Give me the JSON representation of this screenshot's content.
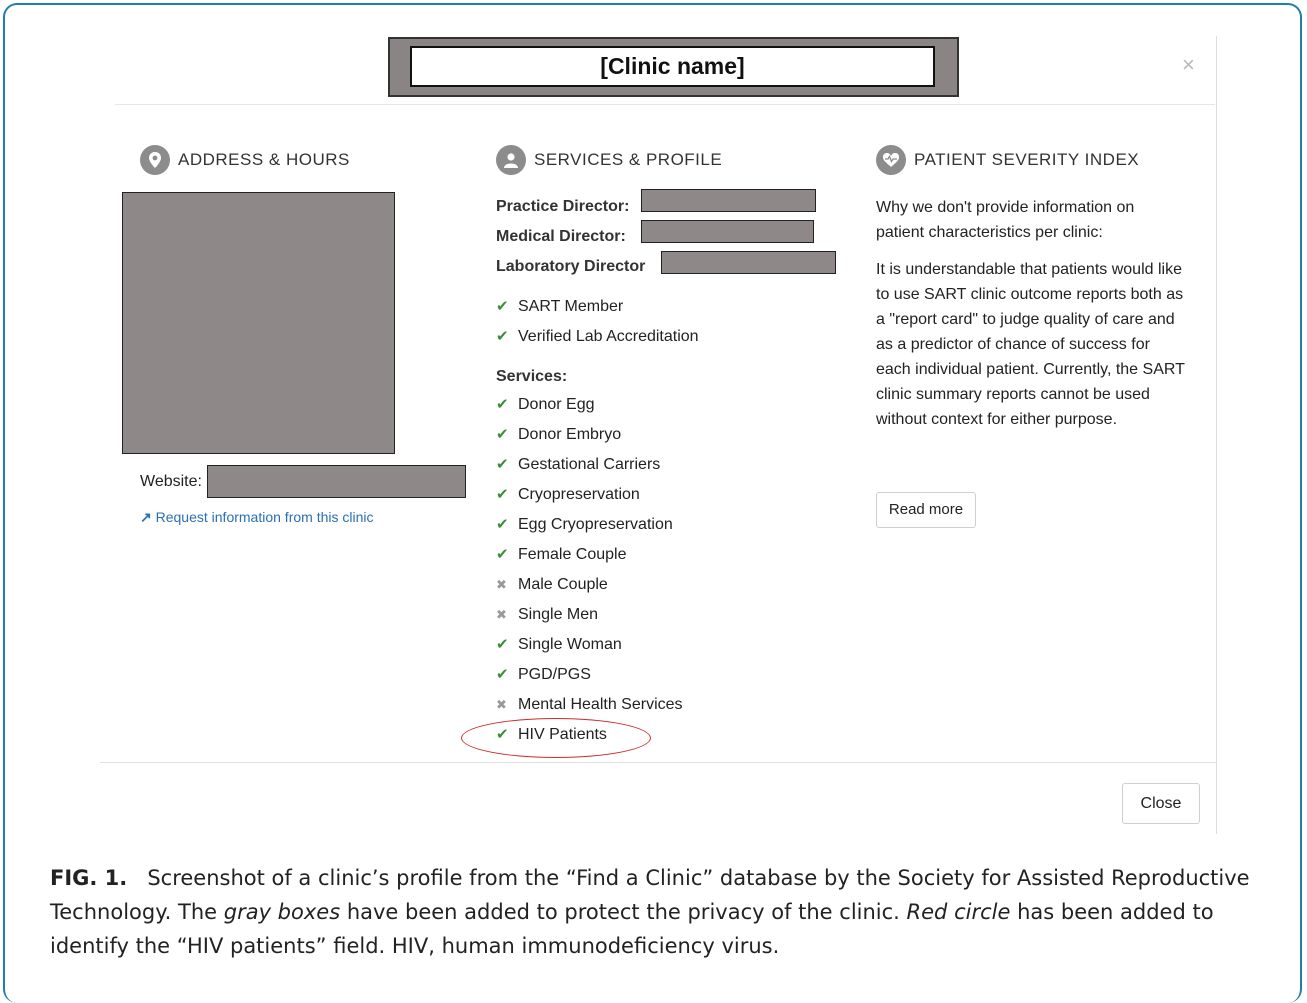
{
  "modal": {
    "title": "[Clinic name]",
    "close_x": "×",
    "close_button": "Close"
  },
  "address": {
    "heading": "ADDRESS & HOURS",
    "website_label": "Website:",
    "request_link": "Request information from this clinic"
  },
  "services_profile": {
    "heading": "SERVICES & PROFILE",
    "practice_director": "Practice Director:",
    "medical_director": "Medical Director:",
    "laboratory_director": "Laboratory Director",
    "badges": [
      {
        "label": "SART Member",
        "available": true
      },
      {
        "label": "Verified Lab Accreditation",
        "available": true
      }
    ],
    "services_label": "Services:",
    "services": [
      {
        "label": "Donor Egg",
        "available": true
      },
      {
        "label": "Donor Embryo",
        "available": true
      },
      {
        "label": "Gestational Carriers",
        "available": true
      },
      {
        "label": "Cryopreservation",
        "available": true
      },
      {
        "label": "Egg Cryopreservation",
        "available": true
      },
      {
        "label": "Female Couple",
        "available": true
      },
      {
        "label": "Male Couple",
        "available": false
      },
      {
        "label": "Single Men",
        "available": false
      },
      {
        "label": "Single Woman",
        "available": true
      },
      {
        "label": "PGD/PGS",
        "available": true
      },
      {
        "label": "Mental Health Services",
        "available": false
      },
      {
        "label": "HIV Patients",
        "available": true
      }
    ],
    "check_glyph": "✔",
    "cross_glyph": "✖"
  },
  "severity": {
    "heading": "PATIENT SEVERITY INDEX",
    "intro": "Why we don't provide information on patient characteristics per clinic:",
    "body": "It is understandable that patients would like to use SART clinic outcome reports both as a \"report card\" to judge quality of care and as a predictor of chance of success for each individual patient. Currently, the SART clinic summary reports cannot be used without context for either purpose.",
    "read_more": "Read more"
  },
  "caption": {
    "label": "FIG. 1.",
    "text_1": "Screenshot of a clinic’s profile from the “Find a Clinic” database by the Society for Assisted Reproductive Technology. The ",
    "em_1": "gray boxes",
    "text_2": " have been added to protect the privacy of the clinic. ",
    "em_2": "Red circle",
    "text_3": " has been added to identify the “HIV patients” field. HIV, human immunodeficiency virus."
  },
  "colors": {
    "frame_border": "#1f7fa8",
    "redaction_gray": "#8e8888",
    "check_green": "#3c8c3c",
    "link_blue": "#2a6fb5",
    "annotation_red": "#cc2b2b"
  }
}
